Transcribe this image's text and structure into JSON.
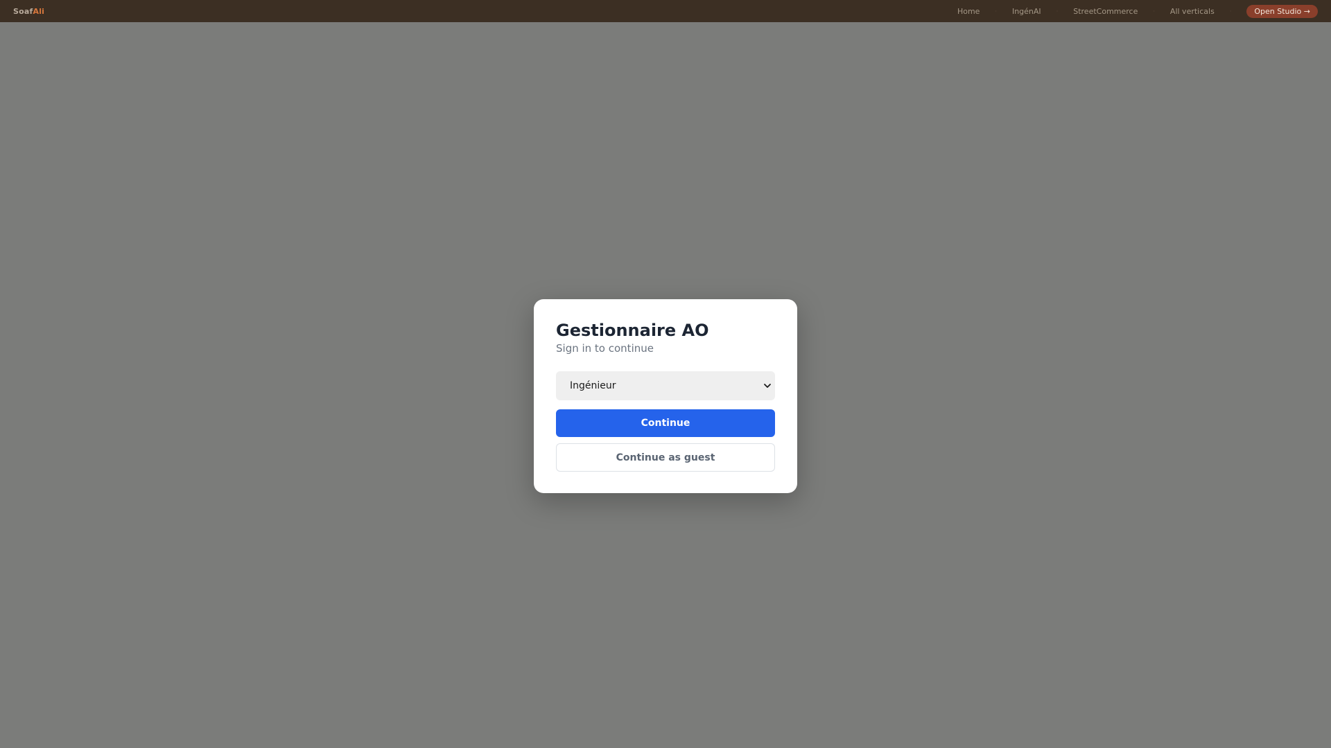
{
  "header": {
    "brand_part1": "Soaf",
    "brand_part2": "Ali",
    "nav": [
      {
        "label": "Home"
      },
      {
        "label": "IngénAI"
      },
      {
        "label": "StreetCommerce"
      },
      {
        "label": "All verticals"
      }
    ],
    "separator": "·",
    "cta_label": "Open Studio →"
  },
  "modal": {
    "title": "Gestionnaire AO",
    "subtitle": "Sign in to continue",
    "role_select": {
      "selected": "Ingénieur",
      "icon": "chevron-down-icon"
    },
    "continue_label": "Continue",
    "guest_label": "Continue as guest"
  },
  "colors": {
    "topbar_bg": "#3c2f23",
    "overlay_bg": "#7b7c7a",
    "brand_accent": "#d9783d",
    "cta_bg": "#8a3f2b",
    "primary_button": "#2563eb"
  }
}
